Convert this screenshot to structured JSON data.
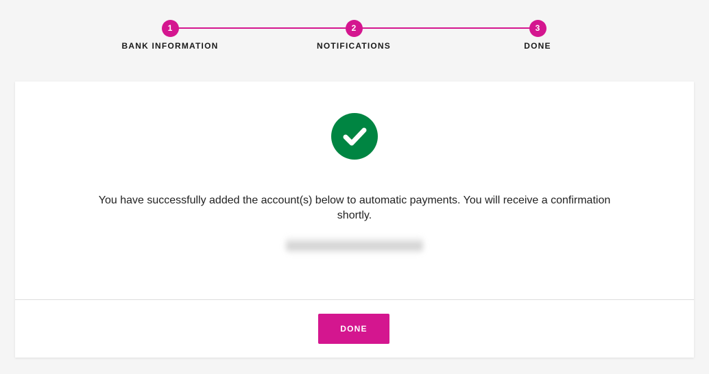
{
  "stepper": {
    "steps": [
      {
        "number": "1",
        "label": "BANK INFORMATION"
      },
      {
        "number": "2",
        "label": "NOTIFICATIONS"
      },
      {
        "number": "3",
        "label": "DONE"
      }
    ]
  },
  "confirmation": {
    "icon": "check-circle-icon",
    "message": "You have successfully added the account(s) below to automatic payments. You will receive a confirmation shortly."
  },
  "footer": {
    "done_label": "DONE"
  },
  "colors": {
    "accent": "#d4168f",
    "success": "#008542",
    "background": "#f5f5f5",
    "card": "#ffffff"
  }
}
